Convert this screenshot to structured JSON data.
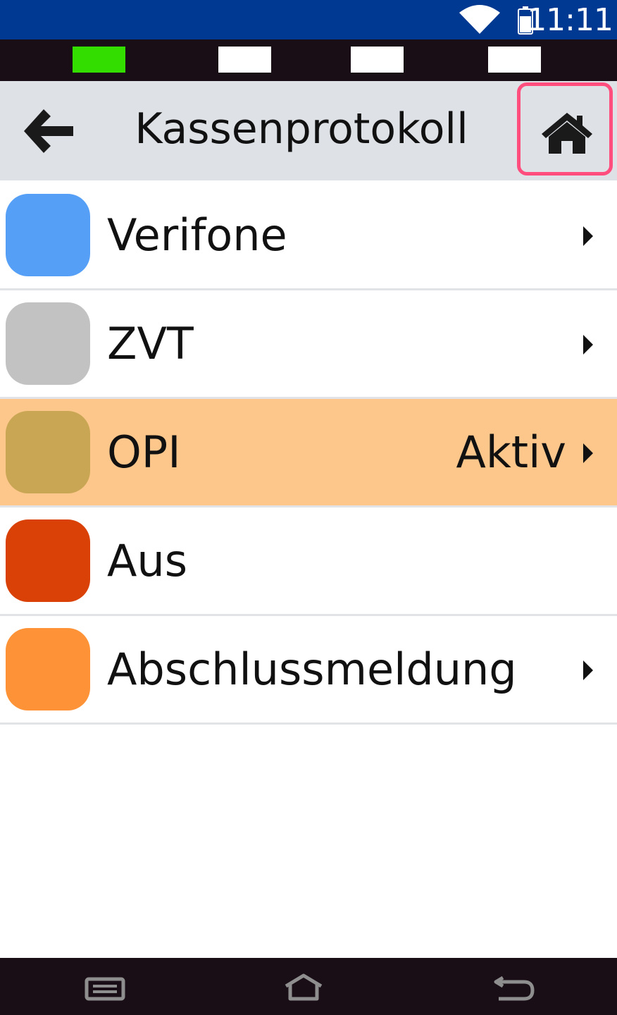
{
  "status_bar": {
    "time": "11:11",
    "wifi_icon": "wifi-icon",
    "battery_icon": "battery-icon"
  },
  "indicators": [
    {
      "color": "#33dd00"
    },
    {
      "color": "#ffffff"
    },
    {
      "color": "#ffffff"
    },
    {
      "color": "#ffffff"
    }
  ],
  "header": {
    "title": "Kassenprotokoll",
    "back_icon": "arrow-left-icon",
    "home_icon": "home-icon"
  },
  "list": {
    "items": [
      {
        "label": "Verifone",
        "status": "",
        "color": "#559ff7",
        "chevron": true,
        "active": false
      },
      {
        "label": "ZVT",
        "status": "",
        "color": "#c2c2c2",
        "chevron": true,
        "active": false
      },
      {
        "label": "OPI",
        "status": "Aktiv",
        "color": "#c9a653",
        "chevron": true,
        "active": true
      },
      {
        "label": "Aus",
        "status": "",
        "color": "#d94106",
        "chevron": false,
        "active": false
      },
      {
        "label": "Abschlussmeldung",
        "status": "",
        "color": "#fe9236",
        "chevron": true,
        "active": false
      }
    ]
  },
  "nav_bar": {
    "recent_icon": "recent-apps-icon",
    "home_icon": "nav-home-icon",
    "back_icon": "nav-back-icon"
  },
  "colors": {
    "status_bar": "#003991",
    "title_bar": "#dee1e6",
    "active_row": "#fdc78c",
    "highlight_border": "#ff4d7d"
  }
}
